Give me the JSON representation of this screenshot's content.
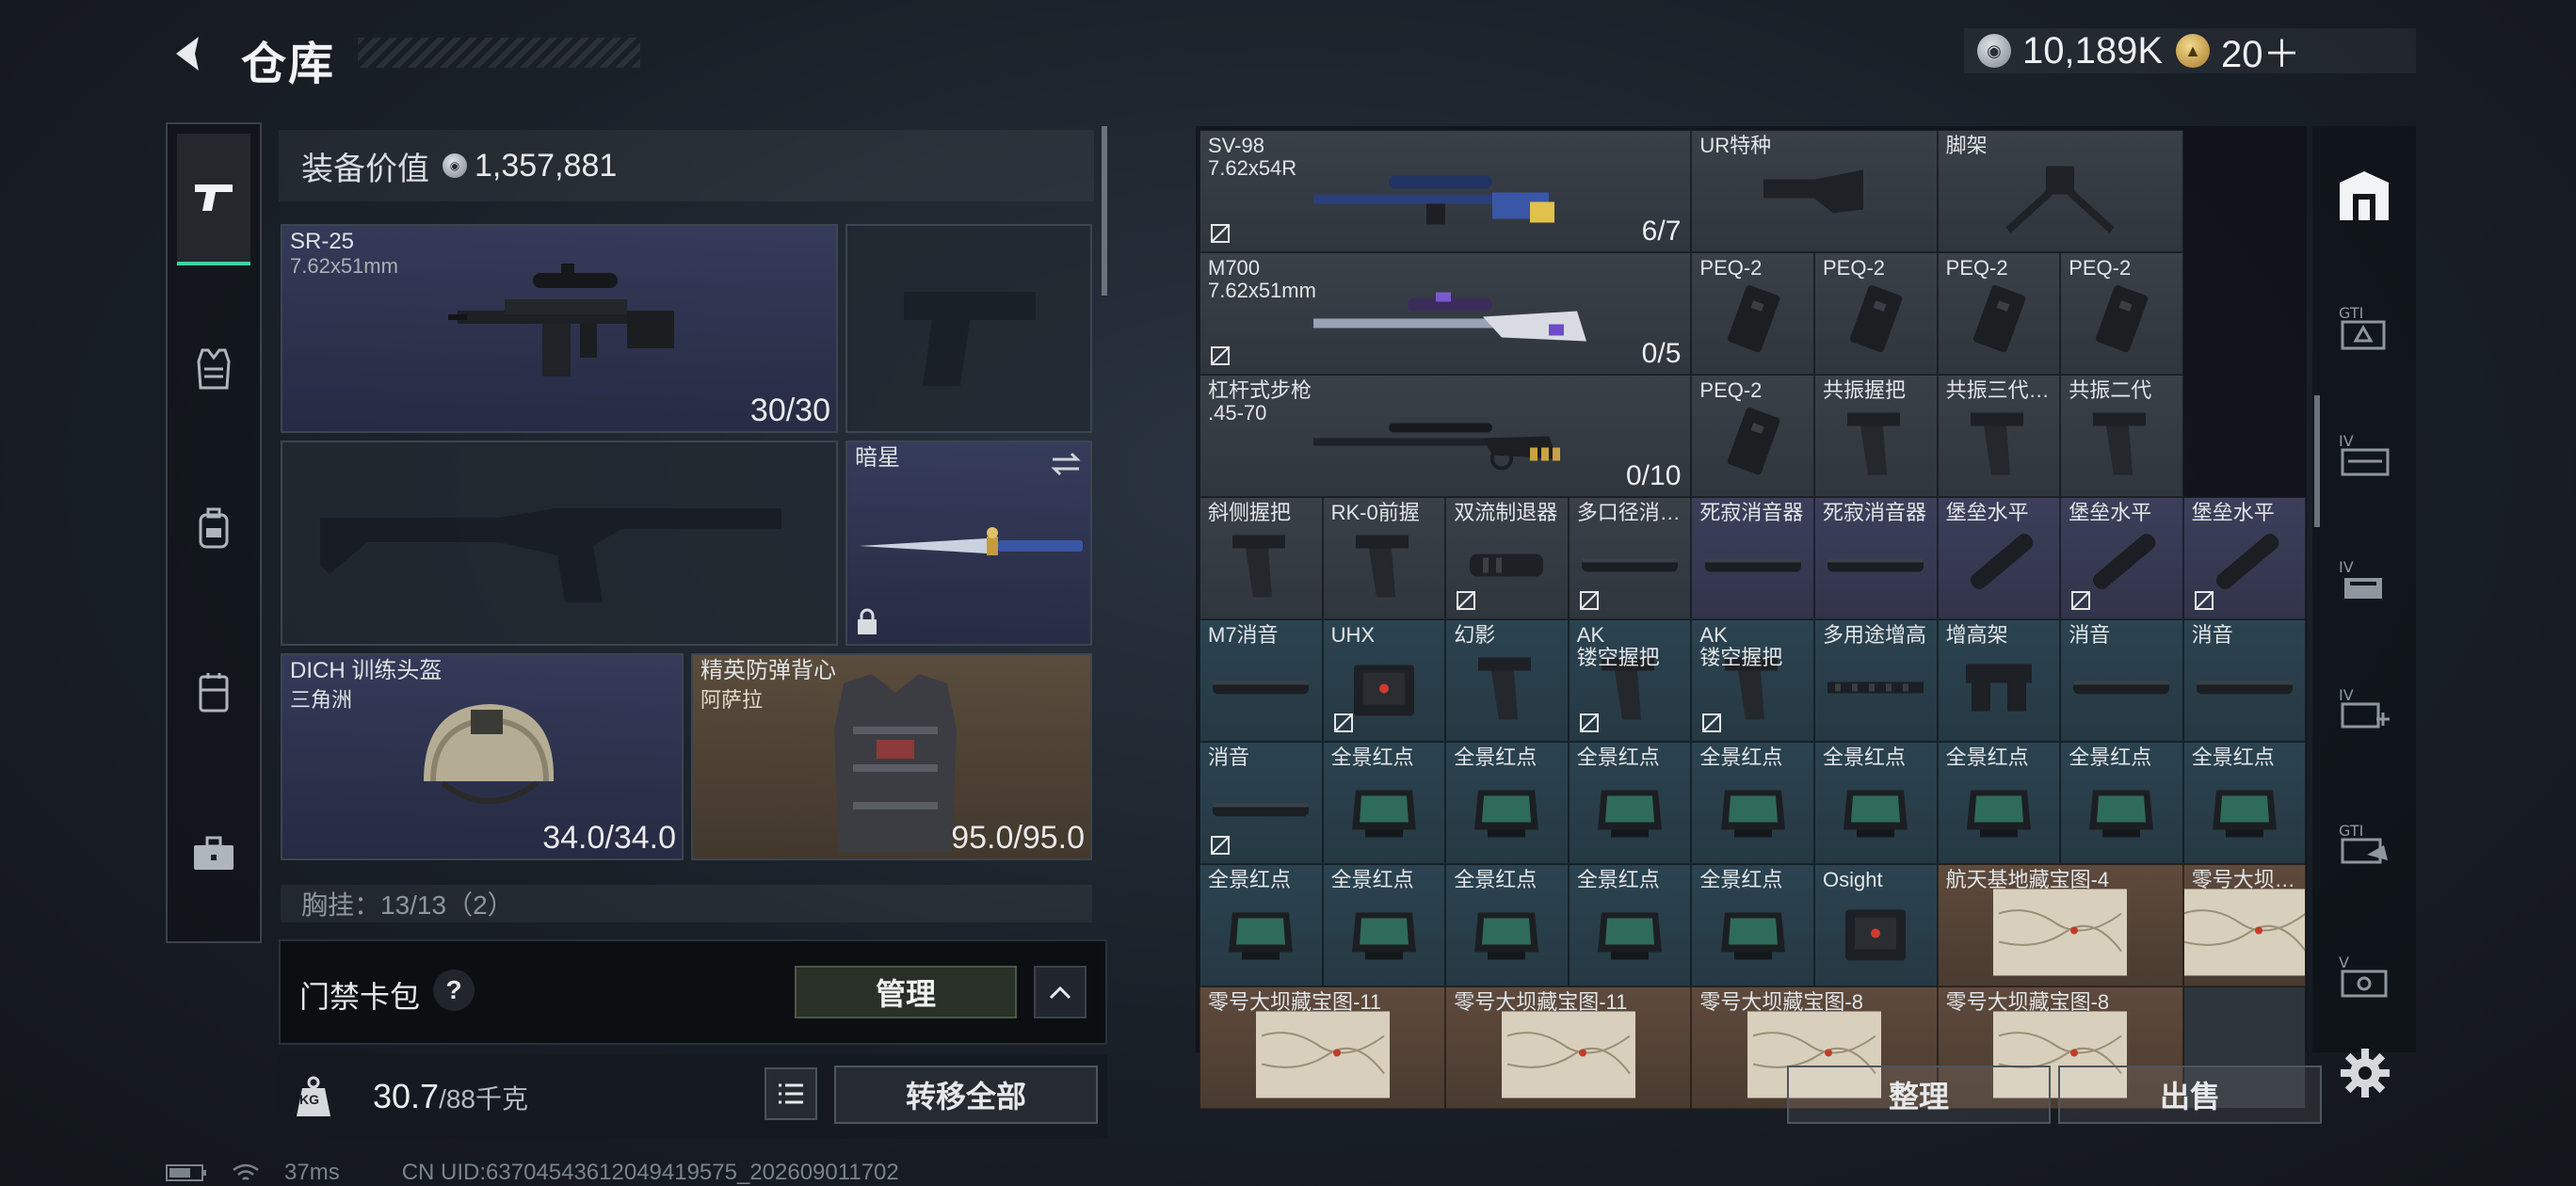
{
  "header": {
    "title": "仓库",
    "currency_silver": "10,189K",
    "currency_gold": "20＋"
  },
  "left_sidebar": {
    "items": [
      {
        "name": "weapons-icon",
        "active": true
      },
      {
        "name": "armor-icon",
        "active": false
      },
      {
        "name": "backpack-icon",
        "active": false
      },
      {
        "name": "rig-icon",
        "active": false
      },
      {
        "name": "case-icon",
        "active": false
      }
    ]
  },
  "loadout": {
    "value_label": "装备价值",
    "value": "1,357,881",
    "primary": {
      "name": "SR-25",
      "caliber": "7.62x51mm",
      "ammo": "30/30"
    },
    "melee": {
      "name": "暗星"
    },
    "helmet": {
      "name": "DICH 训练头盔",
      "sub": "三角洲",
      "durability": "34.0/34.0"
    },
    "vest": {
      "name": "精英防弹背心",
      "sub": "阿萨拉",
      "durability": "95.0/95.0"
    },
    "chest_label": "胸挂：13/13（2）"
  },
  "keycard": {
    "label": "门禁卡包",
    "help": "?",
    "manage_label": "管理"
  },
  "weight": {
    "value": "30.7",
    "max": "/88千克",
    "transfer_label": "转移全部",
    "kg_badge": "KG"
  },
  "grid": {
    "rows": [
      [
        {
          "name": "SV-98\n7.62x54R",
          "num": "6/7",
          "color": "grey",
          "span": 4,
          "icon": "sniper-rifle",
          "mark": true
        },
        {
          "name": "UR特种",
          "color": "grey",
          "span": 2,
          "icon": "stock"
        },
        {
          "name": "脚架",
          "color": "grey",
          "span": 2,
          "icon": "bipod"
        }
      ],
      [
        {
          "name": "M700\n7.62x51mm",
          "num": "0/5",
          "color": "grey",
          "span": 4,
          "icon": "bolt-rifle",
          "mark": true
        },
        {
          "name": "PEQ-2",
          "color": "grey",
          "icon": "laser"
        },
        {
          "name": "PEQ-2",
          "color": "grey",
          "icon": "laser"
        },
        {
          "name": "PEQ-2",
          "color": "grey",
          "icon": "laser"
        },
        {
          "name": "PEQ-2",
          "color": "grey",
          "icon": "laser"
        }
      ],
      [
        {
          "name": "杠杆式步枪\n.45-70",
          "num": "0/10",
          "color": "grey",
          "span": 4,
          "icon": "lever-rifle"
        },
        {
          "name": "PEQ-2",
          "color": "grey",
          "icon": "laser"
        },
        {
          "name": "共振握把",
          "color": "grey",
          "icon": "grip"
        },
        {
          "name": "共振三代…",
          "color": "grey",
          "icon": "grip"
        },
        {
          "name": "共振二代",
          "color": "grey",
          "icon": "grip"
        }
      ],
      [
        {
          "name": "斜侧握把",
          "color": "grey",
          "icon": "grip"
        },
        {
          "name": "RK-0前握",
          "color": "grey",
          "icon": "grip"
        },
        {
          "name": "双流制退器",
          "color": "grey",
          "icon": "muzzle",
          "mark": true
        },
        {
          "name": "多口径消…",
          "color": "grey",
          "icon": "suppressor",
          "mark": true
        },
        {
          "name": "死寂消音器",
          "color": "purple",
          "icon": "suppressor"
        },
        {
          "name": "死寂消音器",
          "color": "purple",
          "icon": "suppressor"
        },
        {
          "name": "堡垒水平",
          "color": "purple",
          "icon": "suppressor-angled"
        },
        {
          "name": "堡垒水平",
          "color": "purple",
          "icon": "suppressor-angled",
          "mark": true
        },
        {
          "name": "堡垒水平",
          "color": "purple",
          "icon": "suppressor-angled",
          "mark": true
        }
      ],
      [
        {
          "name": "M7消音",
          "color": "blue",
          "icon": "suppressor"
        },
        {
          "name": "UHX",
          "color": "blue",
          "icon": "red-dot",
          "mark": true
        },
        {
          "name": "幻影",
          "color": "blue",
          "icon": "grip"
        },
        {
          "name": "AK\n镂空握把",
          "color": "blue",
          "icon": "grip",
          "mark": true
        },
        {
          "name": "AK\n镂空握把",
          "color": "blue",
          "icon": "grip",
          "mark": true
        },
        {
          "name": "多用途增高",
          "color": "blue",
          "icon": "rail"
        },
        {
          "name": "增高架",
          "color": "blue",
          "icon": "mount"
        },
        {
          "name": "消音",
          "color": "blue",
          "icon": "suppressor"
        },
        {
          "name": "消音",
          "color": "blue",
          "icon": "suppressor"
        }
      ],
      [
        {
          "name": "消音",
          "color": "blue",
          "icon": "suppressor",
          "mark": true
        },
        {
          "name": "全景红点",
          "color": "blue",
          "icon": "holo"
        },
        {
          "name": "全景红点",
          "color": "blue",
          "icon": "holo"
        },
        {
          "name": "全景红点",
          "color": "blue",
          "icon": "holo"
        },
        {
          "name": "全景红点",
          "color": "blue",
          "icon": "holo"
        },
        {
          "name": "全景红点",
          "color": "blue",
          "icon": "holo"
        },
        {
          "name": "全景红点",
          "color": "blue",
          "icon": "holo"
        },
        {
          "name": "全景红点",
          "color": "blue",
          "icon": "holo"
        },
        {
          "name": "全景红点",
          "color": "blue",
          "icon": "holo"
        }
      ],
      [
        {
          "name": "全景红点",
          "color": "blue",
          "icon": "holo"
        },
        {
          "name": "全景红点",
          "color": "blue",
          "icon": "holo"
        },
        {
          "name": "全景红点",
          "color": "blue",
          "icon": "holo"
        },
        {
          "name": "全景红点",
          "color": "blue",
          "icon": "holo"
        },
        {
          "name": "全景红点",
          "color": "blue",
          "icon": "holo"
        },
        {
          "name": "Osight",
          "color": "blue",
          "icon": "red-dot"
        },
        {
          "name": "航天基地藏宝图-4",
          "color": "brown",
          "span": 2,
          "icon": "map"
        },
        {
          "name": "零号大坝…",
          "color": "brown",
          "icon": "map"
        }
      ],
      [
        {
          "name": "零号大坝藏宝图-11",
          "color": "brown",
          "span": 2,
          "icon": "map"
        },
        {
          "name": "零号大坝藏宝图-11",
          "color": "brown",
          "span": 2,
          "icon": "map"
        },
        {
          "name": "零号大坝藏宝图-8",
          "color": "brown",
          "span": 2,
          "icon": "map"
        },
        {
          "name": "零号大坝藏宝图-8",
          "color": "brown",
          "span": 2,
          "icon": "map"
        },
        {
          "name": "",
          "color": "dark",
          "icon": ""
        }
      ]
    ],
    "sort_label": "整理",
    "sell_label": "出售"
  },
  "right_sidebar": {
    "items": [
      "warehouse-icon",
      "gti-filter-icon",
      "iv-filter-icon",
      "iv-stack-icon",
      "iv-plus-icon",
      "gti-hand-icon",
      "v-chest-icon"
    ]
  },
  "status_bar": {
    "ping": "37ms",
    "uid": "CN UID:637045436120494195​75_202609011702"
  },
  "colors": {
    "accent_green": "#3fd3a5",
    "grey_cell": "#3a4048",
    "purple_cell": "#3c3f5a",
    "blue_cell": "#2b4350",
    "brown_cell": "#5e4a3c"
  }
}
